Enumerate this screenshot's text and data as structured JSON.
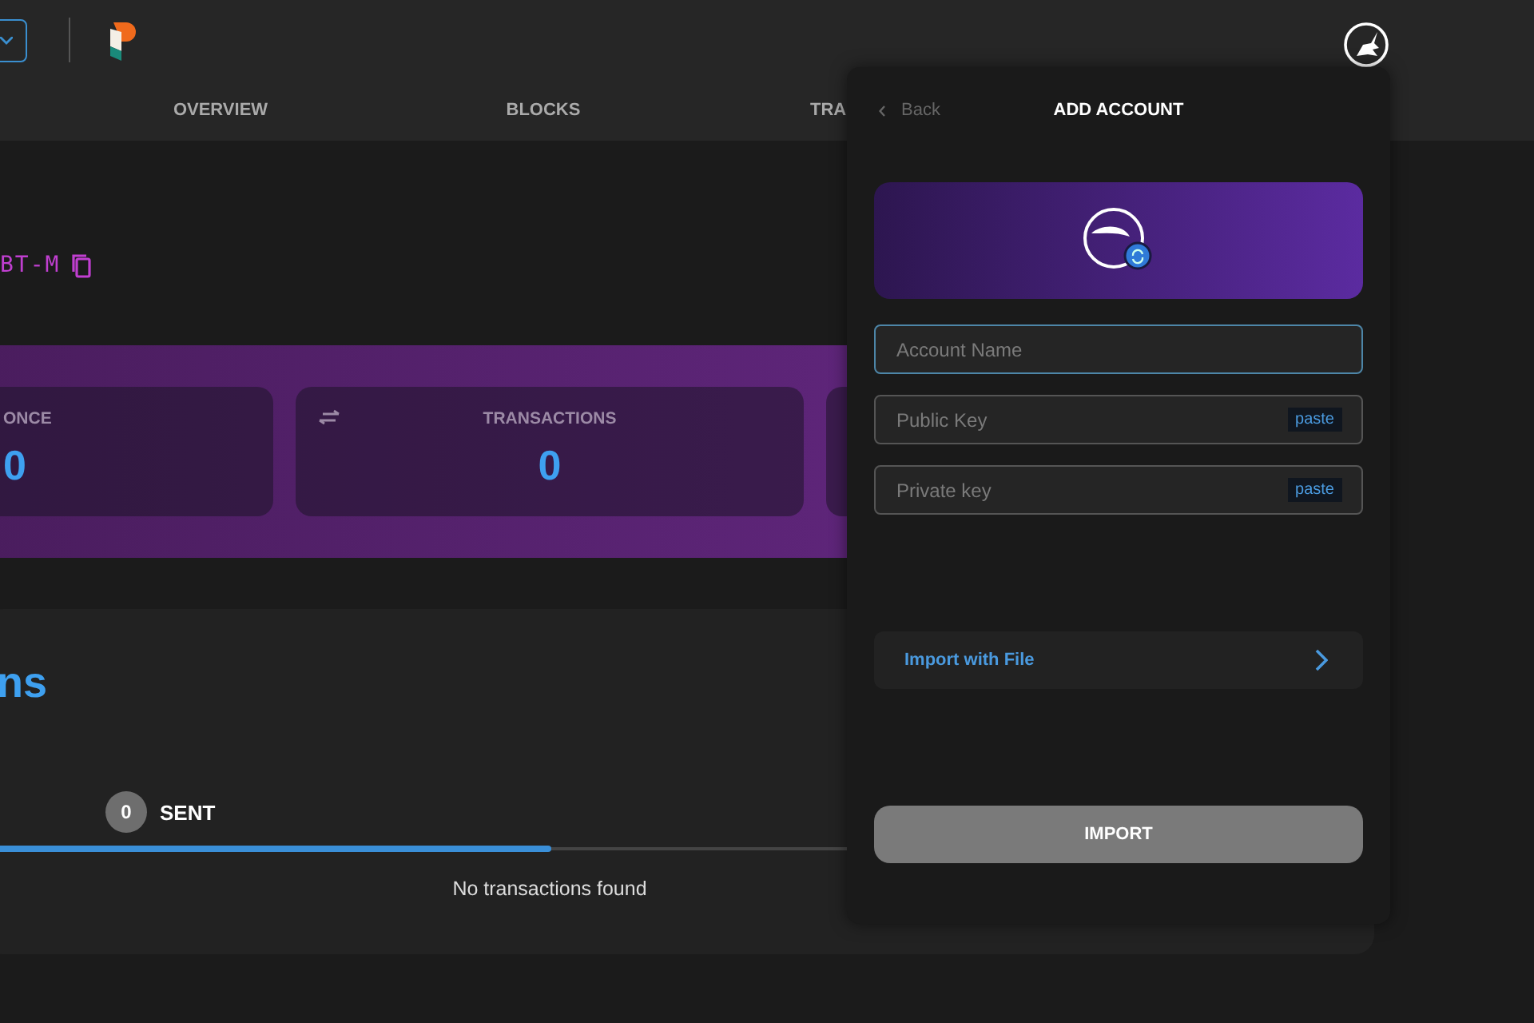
{
  "header": {
    "nav_tabs": [
      {
        "label": "OVERVIEW",
        "kind": "full"
      },
      {
        "label": "BLOCKS",
        "kind": "full"
      },
      {
        "label": "TRA",
        "kind": "cut"
      }
    ]
  },
  "account": {
    "address": "BT-M"
  },
  "stats": [
    {
      "label": "ONCE",
      "value": "0",
      "kind": "plain"
    },
    {
      "label": "TRANSACTIONS",
      "value": "0",
      "kind": "transfer"
    }
  ],
  "transactions": {
    "title": "ns",
    "tabs": [
      {
        "count": "0",
        "label": "SENT"
      }
    ],
    "empty_text": "No transactions found"
  },
  "dialog": {
    "back": "Back",
    "title": "ADD ACCOUNT",
    "fields": [
      {
        "placeholder": "Account Name",
        "focused": true
      },
      {
        "placeholder": "Public Key",
        "focused": false,
        "action": "paste"
      },
      {
        "placeholder": "Private key",
        "focused": false,
        "action": "paste"
      }
    ],
    "import_file": "Import with File",
    "submit": "IMPORT"
  }
}
